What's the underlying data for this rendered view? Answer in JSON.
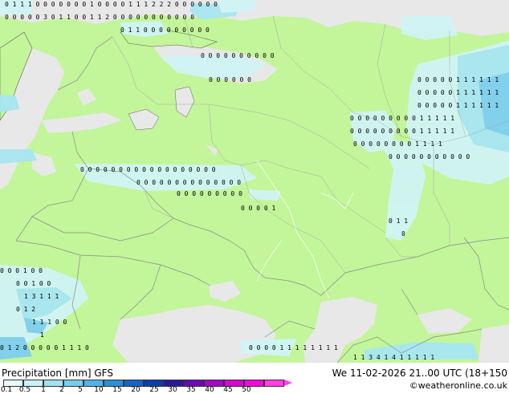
{
  "map": {
    "colors": {
      "land": "#c3f59a",
      "sea": "#e8e8e8",
      "precip_light": "#d0f4f4",
      "precip_mid": "#a8e6f2",
      "precip_high": "#7fcff0",
      "borders": "#8a8a8a",
      "coast": "#606060"
    }
  },
  "footer": {
    "title": "Precipitation [mm]  GFS",
    "timestamp": "We 11-02-2026 21..00 UTC (18+150",
    "credit": "©weatheronline.co.uk",
    "scale": {
      "labels": [
        "0.1",
        "0.5",
        "1",
        "2",
        "5",
        "10",
        "15",
        "20",
        "25",
        "30",
        "35",
        "40",
        "45",
        "50"
      ],
      "colors": [
        "#e6fafa",
        "#c8f0f8",
        "#a0e2f4",
        "#78cdef",
        "#50b4e8",
        "#2a8fd8",
        "#1466c4",
        "#0a3ea8",
        "#2a1a96",
        "#6a0ab0",
        "#a20ac2",
        "#d40ad0",
        "#f00ad8",
        "#ff40e6"
      ]
    }
  }
}
